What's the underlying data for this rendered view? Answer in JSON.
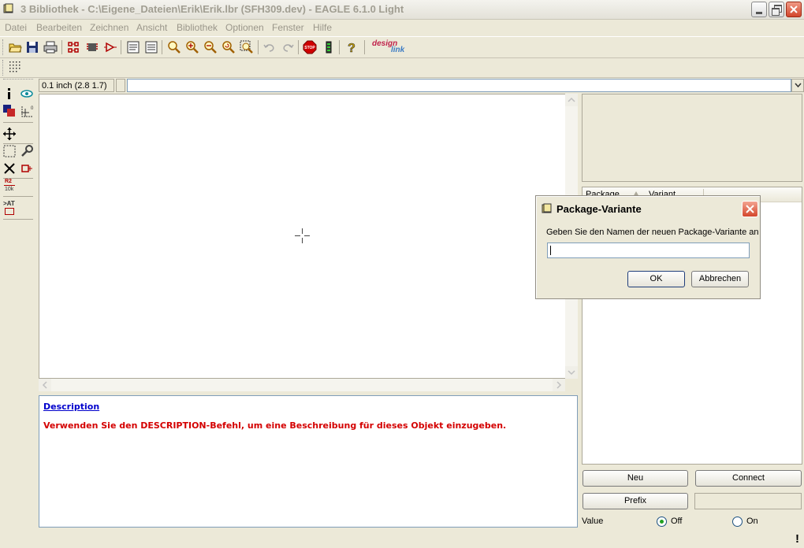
{
  "window": {
    "title": "3 Bibliothek - C:\\Eigene_Dateien\\Erik\\Erik.lbr (SFH309.dev) - EAGLE 6.1.0 Light"
  },
  "menu": [
    "Datei",
    "Bearbeiten",
    "Zeichnen",
    "Ansicht",
    "Bibliothek",
    "Optionen",
    "Fenster",
    "Hilfe"
  ],
  "toolbar": {
    "icons": [
      "open-icon",
      "save-icon",
      "print-icon",
      "symbol-icon",
      "package-icon",
      "device-icon",
      "script-icon",
      "ulp-icon",
      "zoom-fit-icon",
      "zoom-in-icon",
      "zoom-out-icon",
      "zoom-redraw-icon",
      "zoom-select-icon",
      "undo-icon",
      "redo-icon",
      "stop-icon",
      "go-icon",
      "help-icon",
      "design-link-icon"
    ],
    "design_link_top": "design",
    "design_link_bottom": "link",
    "stop_text": "STOP",
    "help_text": "?"
  },
  "coordinates": "0.1 inch (2.8 1.7)",
  "left_tools": {
    "r2_label": "R2",
    "r2_value": "10k",
    "smash_label": ">AT"
  },
  "description": {
    "heading": "Description",
    "text": "Verwenden Sie den DESCRIPTION-Befehl, um eine Beschreibung für dieses Objekt einzugeben."
  },
  "packages": {
    "col1": "Package",
    "col2": "Variant"
  },
  "buttons": {
    "new": "Neu",
    "connect": "Connect",
    "prefix": "Prefix"
  },
  "value": {
    "label": "Value",
    "off": "Off",
    "on": "On",
    "selected": "Off"
  },
  "dialog": {
    "title": "Package-Variante",
    "message": "Geben Sie den Namen der neuen Package-Variante an",
    "input_value": "",
    "ok": "OK",
    "cancel": "Abbrechen"
  },
  "colors": {
    "window_bg": "#ece9d8",
    "description_heading": "#0000cc",
    "description_text": "#d40000",
    "radio_checked": "#21a121"
  }
}
